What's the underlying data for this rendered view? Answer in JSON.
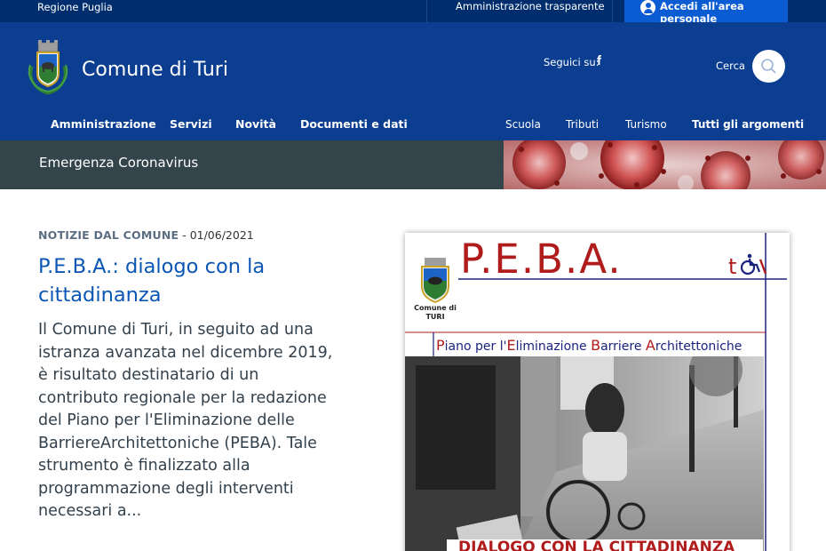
{
  "slim_header": {
    "region": "Regione Puglia",
    "transparency_link": "Amministrazione trasparente",
    "login_button": "Accedi all'area personale"
  },
  "header": {
    "site_name": "Comune di Turi",
    "social_label": "Seguici su:",
    "social_icon": "f",
    "search_label": "Cerca"
  },
  "nav_main": [
    "Amministrazione",
    "Servizi",
    "Novità",
    "Documenti e dati"
  ],
  "nav_secondary": [
    "Scuola",
    "Tributi",
    "Turismo",
    "Tutti gli argomenti"
  ],
  "banner": {
    "title": "Emergenza Coronavirus"
  },
  "article": {
    "category": "NOTIZIE DAL COMUNE",
    "date": " - 01/06/2021",
    "title": "P.E.B.A.: dialogo con la cittadinanza",
    "abstract": "Il Comune di Turi, in seguito ad una istranza avanzata nel dicembre 2019, è risultato destinatario di un contributo regionale per la redazione del Piano per l'Eliminazione delle BarriereArchitettoniche (PEBA). Tale strumento è finalizzato alla programmazione degli interventi necessari a..."
  },
  "poster": {
    "title": "P.E.B.A.",
    "crest_label": "Comune di TURI",
    "subtitle_parts": [
      {
        "initial": "P",
        "rest": "iano per l'"
      },
      {
        "initial": "E",
        "rest": "liminazione "
      },
      {
        "initial": "B",
        "rest": "arriere "
      },
      {
        "initial": "A",
        "rest": "rchitettoniche"
      }
    ],
    "band_text": "DIALOGO CON LA CITTADINANZA"
  },
  "colors": {
    "slim_bg": "#002d6e",
    "header_bg": "#0b3d91",
    "login_bg": "#0b5cd2",
    "banner_bg": "#34444b",
    "headline": "#0b56b4",
    "poster_red": "#b01c1c"
  }
}
